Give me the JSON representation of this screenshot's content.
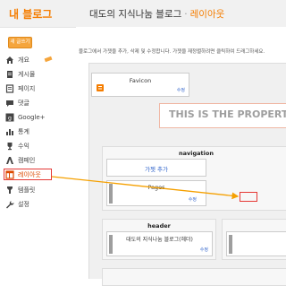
{
  "header": {
    "brand": "내 블로그",
    "blog_name": "대도의 지식나눔 블로그",
    "separator": "·",
    "section": "레이아웃"
  },
  "sidebar": {
    "new_post": "새 글쓰기",
    "items": [
      {
        "label": "개요",
        "icon": "home-icon"
      },
      {
        "label": "게시물",
        "icon": "document-icon"
      },
      {
        "label": "페이지",
        "icon": "page-icon"
      },
      {
        "label": "댓글",
        "icon": "comment-icon"
      },
      {
        "label": "Google+",
        "icon": "google-plus-icon"
      },
      {
        "label": "통계",
        "icon": "stats-icon"
      },
      {
        "label": "수익",
        "icon": "trophy-icon"
      },
      {
        "label": "캠페인",
        "icon": "campaign-icon"
      },
      {
        "label": "레이아웃",
        "icon": "layout-icon"
      },
      {
        "label": "템플릿",
        "icon": "template-icon"
      },
      {
        "label": "설정",
        "icon": "wrench-icon"
      }
    ],
    "active_index": 8
  },
  "main": {
    "intro": "블로그에서 가젯을 추가, 삭제 및 수정합니다. 가젯을 재정렬하려면 클릭하여 드래그하세요.",
    "favicon": {
      "title": "Favicon",
      "edit": "수정"
    },
    "property_banner": "THIS IS THE PROPERTY OF",
    "navigation": {
      "title": "navigation",
      "add_gadget": "가젯 추가",
      "pages_title": "Pages",
      "pages_edit": "수정"
    },
    "header_section": {
      "title": "header",
      "gadget_title": "대도의 지식나눔 블로그(헤더)",
      "edit": "수정"
    }
  },
  "colors": {
    "brand": "#f57d00",
    "highlight": "#e53935",
    "arrow": "#f5a000",
    "link": "#3366cc"
  }
}
